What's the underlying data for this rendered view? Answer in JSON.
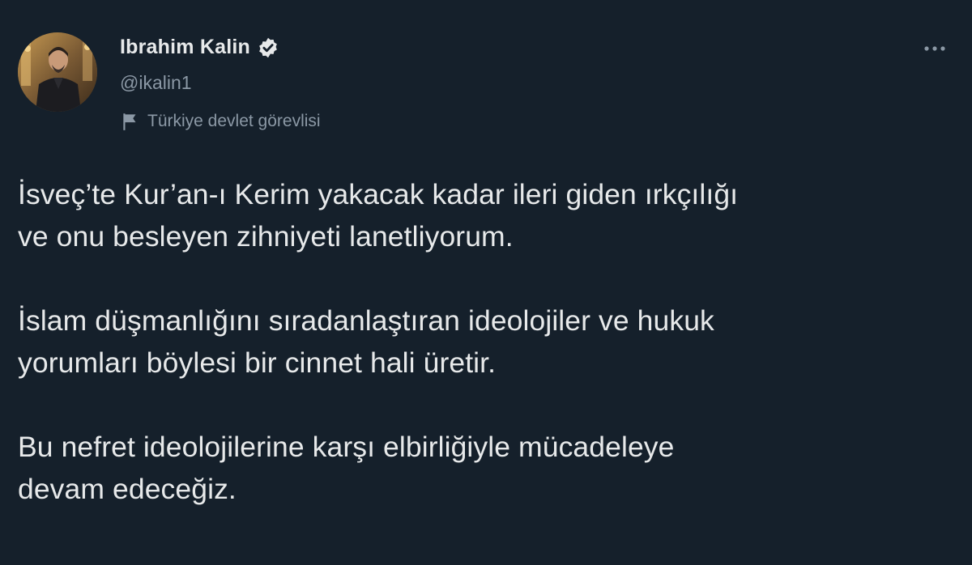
{
  "author": {
    "display_name": "Ibrahim Kalin",
    "handle": "@ikalin1",
    "verified_icon": "verified-badge-icon",
    "label_icon": "flag-icon",
    "label": "Türkiye devlet görevlisi"
  },
  "menu": {
    "icon": "more-options-icon"
  },
  "tweet": {
    "paragraphs": [
      {
        "line1": "İsveç’te Kur’an-ı Kerim yakacak kadar ileri giden ırkçılığı",
        "line2": "ve onu besleyen zihniyeti lanetliyorum."
      },
      {
        "line1": "İslam düşmanlığını sıradanlaştıran ideolojiler ve hukuk",
        "line2": "yorumları böylesi bir cinnet hali üretir."
      },
      {
        "line1": "Bu nefret ideolojilerine karşı elbirliğiyle mücadeleye",
        "line2": "devam edeceğiz."
      }
    ]
  },
  "colors": {
    "background": "#15202b",
    "primary_text": "#e7e9ea",
    "secondary_text": "#8b98a5"
  }
}
